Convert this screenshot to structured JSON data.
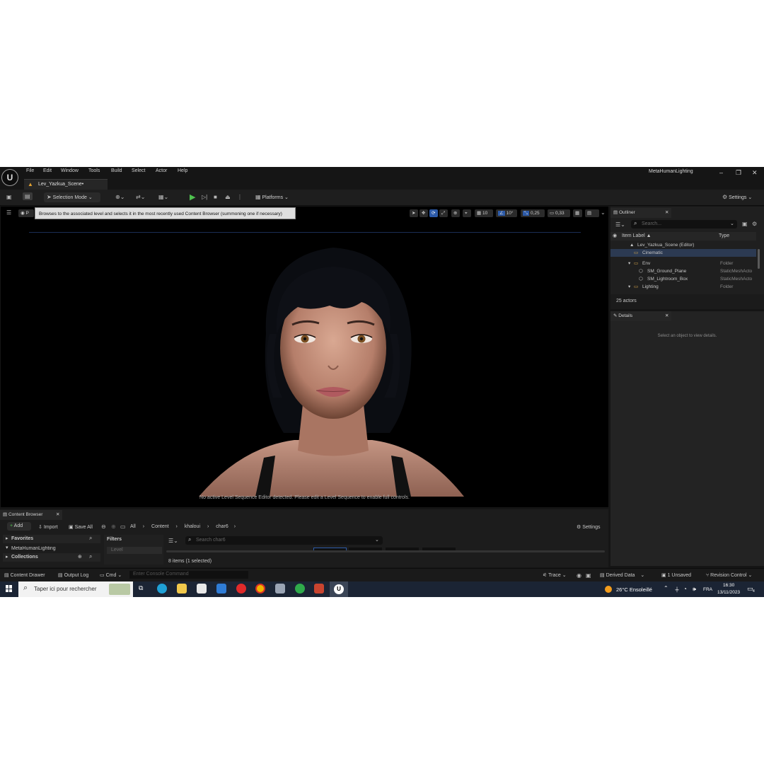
{
  "menu": {
    "items": [
      "File",
      "Edit",
      "Window",
      "Tools",
      "Build",
      "Select",
      "Actor",
      "Help"
    ],
    "project_name": "MetaHumanLighting"
  },
  "document_tab": {
    "label": "Lev_Yazkua_Scene•"
  },
  "toolbar": {
    "selection_mode": "Selection Mode",
    "platforms": "Platforms",
    "settings": "Settings"
  },
  "viewport": {
    "tooltip": "Browses to the associated level and selects it in the most recently used Content Browser (summoning one if necessary)",
    "grid_snap": "10",
    "rotation_snap": "10°",
    "scale_snap": "0,25",
    "camera_speed": "0,33",
    "message": "No active Level Sequence Editor detected. Please edit a Level Sequence to enable full controls."
  },
  "outliner": {
    "tab": "Outliner",
    "search_placeholder": "Search...",
    "col_label": "Item Label ▲",
    "col_type": "Type",
    "rows": [
      {
        "label": "Lev_Yazkua_Scene (Editor)",
        "type": ""
      },
      {
        "label": "Cinematic",
        "type": ""
      },
      {
        "label": "Env",
        "type": "Folder"
      },
      {
        "label": "SM_Ground_Plane",
        "type": "StaticMeshActo"
      },
      {
        "label": "SM_Lightroom_Box",
        "type": "StaticMeshActo"
      },
      {
        "label": "Lighting",
        "type": "Folder"
      }
    ],
    "actor_count": "25 actors"
  },
  "details": {
    "tab": "Details",
    "empty_message": "Select an object to view details."
  },
  "content_browser": {
    "tab": "Content Browser",
    "add": "Add",
    "import": "Import",
    "save_all": "Save All",
    "path": [
      "All",
      "Content",
      "khaloui",
      "char6"
    ],
    "settings": "Settings",
    "favorites": "Favorites",
    "tree_item": "MetaHumanLighting",
    "collections": "Collections",
    "filters": "Filters",
    "filter_item": "Level",
    "search_placeholder": "Search char6",
    "item_count": "8 items (1 selected)"
  },
  "statusbar": {
    "content_drawer": "Content Drawer",
    "output_log": "Output Log",
    "cmd": "Cmd",
    "console_placeholder": "Enter Console Command",
    "trace": "Trace",
    "derived_data": "Derived Data",
    "unsaved": "1 Unsaved",
    "revision_control": "Revision Control"
  },
  "taskbar": {
    "search_placeholder": "Taper ici pour rechercher",
    "weather": "26°C  Ensoleillé",
    "language": "FRA",
    "time": "16:30",
    "date": "13/11/2023",
    "notification_count": "4"
  }
}
